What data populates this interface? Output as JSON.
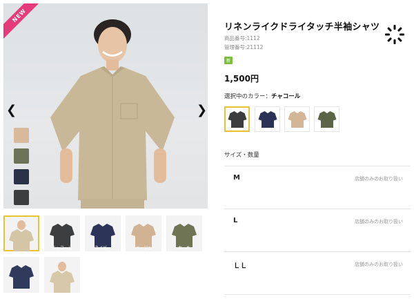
{
  "badge": "NEW",
  "product": {
    "title": "リネンライクドライタッチ半袖シャツ",
    "product_number": "商品番号:1112",
    "management_number": "管理番号:21112",
    "tag": "新",
    "price": "1,500円",
    "selected_color_label": "選択中のカラー：",
    "selected_color": "チャコール"
  },
  "thumbnails": [
    {
      "label": "",
      "color": "#d4c5a5"
    },
    {
      "label": "チャコール",
      "color": "#3d3e40"
    },
    {
      "label": "ネイビー",
      "color": "#2c3457"
    },
    {
      "label": "ベージュ",
      "color": "#d1b394"
    },
    {
      "label": "カーキ",
      "color": "#6f7454"
    },
    {
      "label": "",
      "color": "#2f3a5c"
    },
    {
      "label": "",
      "color": "#d6c8a8"
    }
  ],
  "color_swatches": [
    {
      "name": "チャコール",
      "color": "#3b3c3e"
    },
    {
      "name": "ネイビー",
      "color": "#2a3255"
    },
    {
      "name": "ベージュ",
      "color": "#d3b597"
    },
    {
      "name": "カーキ",
      "color": "#5c6448"
    }
  ],
  "sizes_title": "サイズ・数量",
  "sizes": [
    {
      "name": "M",
      "note": "店舗のみのお取り扱い"
    },
    {
      "name": "L",
      "note": "店舗のみのお取り扱い"
    },
    {
      "name": "ＬＬ",
      "note": "店舗のみのお取り扱い"
    }
  ],
  "colors": {
    "accent": "#e8c430",
    "new_ribbon": "#e63b7a",
    "tag": "#7bbf3c"
  },
  "icons": {
    "prev": "chevron-left-icon",
    "next": "chevron-right-icon",
    "loader": "loading-spinner-icon"
  }
}
